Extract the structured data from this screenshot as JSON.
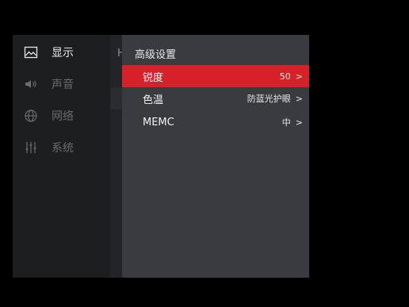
{
  "sidebar": {
    "items": [
      {
        "label": "显示",
        "icon": "image-icon",
        "active": true
      },
      {
        "label": "声音",
        "icon": "speaker-icon",
        "active": false
      },
      {
        "label": "网络",
        "icon": "globe-icon",
        "active": false
      },
      {
        "label": "系统",
        "icon": "sliders-icon",
        "active": false
      }
    ]
  },
  "middle": {
    "clipped_text": "H"
  },
  "panel": {
    "title": "高级设置",
    "rows": [
      {
        "label": "锐度",
        "value": "50",
        "chevron": ">"
      },
      {
        "label": "色温",
        "value": "防蓝光护眼",
        "chevron": ">"
      },
      {
        "label": "MEMC",
        "value": "中",
        "chevron": ">"
      }
    ]
  },
  "colors": {
    "accent": "#d5222a",
    "panel_bg": "#3a3b3e",
    "sidebar_bg": "#1d1e20"
  }
}
